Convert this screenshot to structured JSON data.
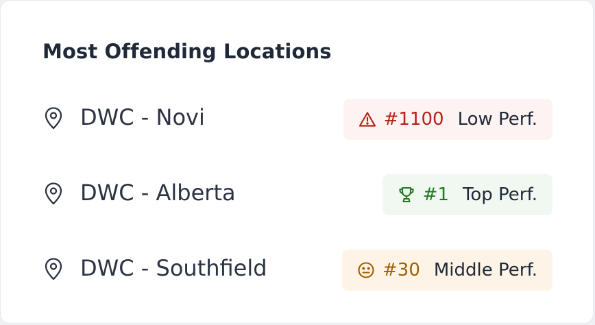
{
  "card": {
    "title": "Most Offending Locations"
  },
  "locations": [
    {
      "name": "DWC - Novi",
      "rank": "#1100",
      "perf_label": "Low Perf.",
      "status_icon": "warning-triangle-icon",
      "color": "#b42318",
      "bg": "#fdf3f2"
    },
    {
      "name": "DWC - Alberta",
      "rank": "#1",
      "perf_label": "Top Perf.",
      "status_icon": "trophy-icon",
      "color": "#1f7a1f",
      "bg": "#f0f8f1"
    },
    {
      "name": "DWC - Southfield",
      "rank": "#30",
      "perf_label": "Middle Perf.",
      "status_icon": "neutral-face-icon",
      "color": "#a35f00",
      "bg": "#fdf4e7"
    }
  ],
  "icons": {
    "location": "map-pin-icon"
  },
  "colors": {
    "text_primary": "#1f2937",
    "text_secondary": "#2b3342",
    "card_background": "#ffffff"
  }
}
